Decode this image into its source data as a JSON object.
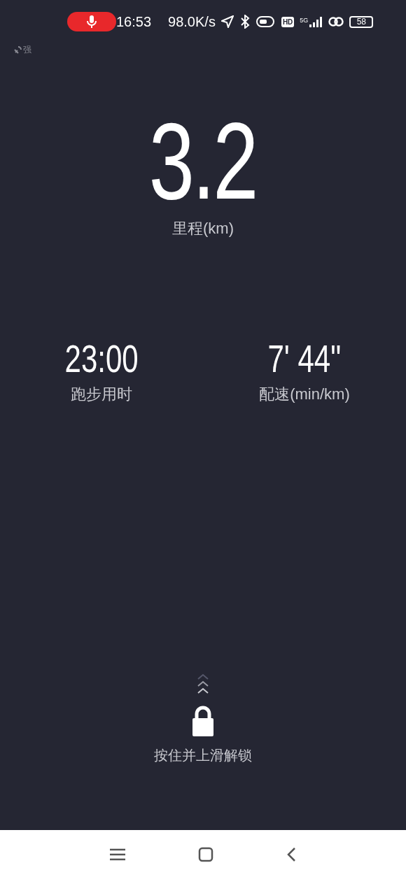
{
  "status_bar": {
    "time": "16:53",
    "speed": "98.0K/s",
    "battery": "58",
    "network": "5G",
    "hd": "HD"
  },
  "gps_signal": "强",
  "distance": {
    "value": "3.2",
    "label": "里程(km)"
  },
  "stats": [
    {
      "value": "23:00",
      "label": "跑步用时"
    },
    {
      "value": "7' 44\"",
      "label": "配速(min/km)"
    }
  ],
  "unlock": {
    "hint": "按住并上滑解锁"
  }
}
